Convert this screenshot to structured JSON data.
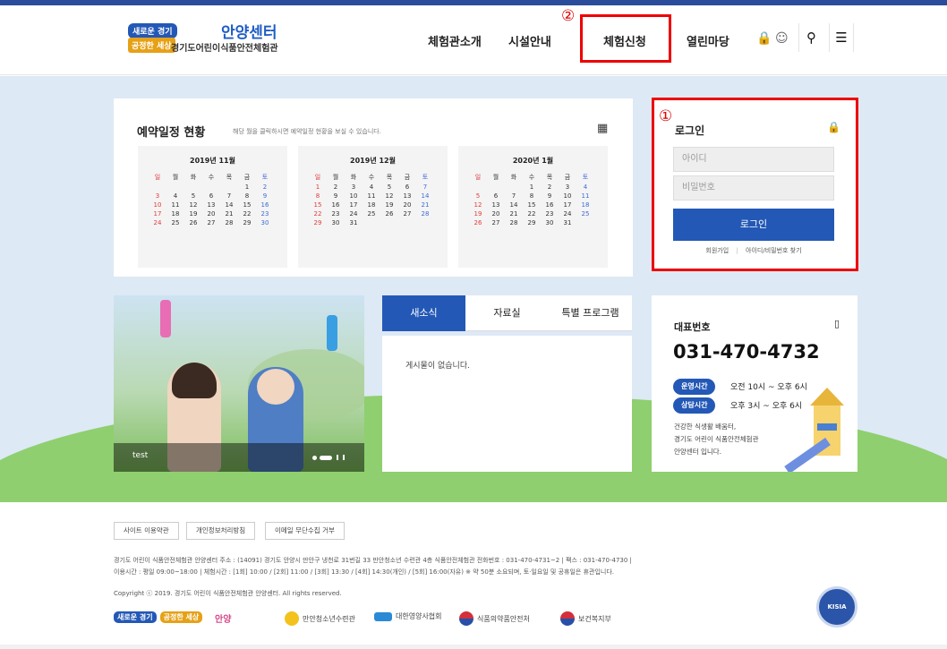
{
  "header": {
    "logo_badge_top": "새로운 경기",
    "logo_badge_bottom": "공정한 세상",
    "logo_title": "안양센터",
    "logo_subtitle": "경기도어린이식품안전체험관",
    "nav": [
      "체험관소개",
      "시설안내",
      "체험신청",
      "열린마당"
    ],
    "marker_2": "②"
  },
  "calendar": {
    "title": "예약일정 현황",
    "description": "해당 월을 클릭하시면 예약일정 현황을 보실 수 있습니다.",
    "weekdays": [
      "일",
      "월",
      "화",
      "수",
      "목",
      "금",
      "토"
    ],
    "months": [
      {
        "title": "2019년 11월",
        "start": 5,
        "days": 30
      },
      {
        "title": "2019년 12월",
        "start": 0,
        "days": 31
      },
      {
        "title": "2020년 1월",
        "start": 3,
        "days": 31
      }
    ]
  },
  "login": {
    "marker_1": "①",
    "title": "로그인",
    "id_placeholder": "아이디",
    "pw_placeholder": "비밀번호",
    "button": "로그인",
    "join_link": "회원가입",
    "find_link": "아이디/비밀번호 찾기"
  },
  "slide": {
    "caption": "test"
  },
  "board": {
    "tabs": [
      "새소식",
      "자료실",
      "특별 프로그램"
    ],
    "active_tab": 0,
    "empty_text": "게시물이 없습니다."
  },
  "contact": {
    "label": "대표번호",
    "phone": "031-470-4732",
    "hours_label": "운영시간",
    "hours_value": "오전 10시 ~ 오후 6시",
    "consult_label": "상담시간",
    "consult_value": "오후 3시 ~ 오후 6시",
    "desc_lines": [
      "건강한 식생활 배움터,",
      "경기도 어린이 식품안전체험관",
      "안양센터 입니다."
    ]
  },
  "footer": {
    "buttons": [
      "사이트 이용약관",
      "개인정보처리방침",
      "이메일 무단수집 거부"
    ],
    "address_line": "경기도 어린이 식품안전체험관 안양센터     주소 : (14091) 경기도 안양시 만안구 냉천로 31번길 33 만안청소년 수련관 4층 식품안전체험관     전화번호 : 031-470-4731~2  |  팩스 : 031-470-4730  |",
    "hours_line": "이용시간 : 평일 09:00~18:00  |  체험시간 : [1회] 10:00 / [2회] 11:00 / [3회] 13:30 / [4회] 14:30(개인) / [5회] 16:00(자유) ※ 약 50분 소요되며, 토·일요일 및 공휴일은 휴관입니다.",
    "copyright": "Copyright ⓒ 2019. 경기도 어린이 식품안전체험관 안양센터. All rights reserved.",
    "partners": [
      "새로운 경기",
      "공정한 세상",
      "안양",
      "만안청소년수련관",
      "대한영양사협회",
      "식품의약품안전처",
      "보건복지부"
    ],
    "seal_text": "KISIA"
  },
  "colors": {
    "primary": "#2358b6",
    "highlight": "#e00000",
    "accent": "#e6a117"
  }
}
